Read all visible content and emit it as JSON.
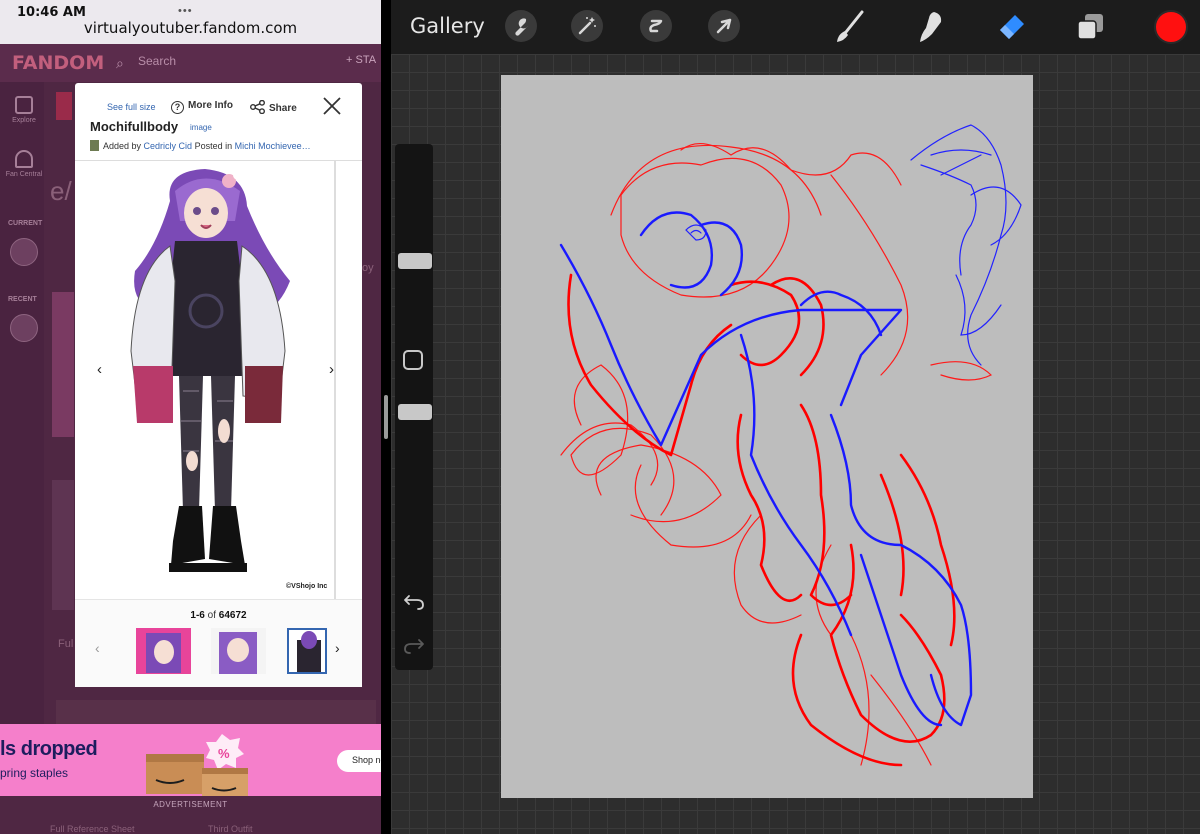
{
  "status_bar": {
    "time": "10:46 AM",
    "dots": "•••",
    "url": "virtualyoutuber.fandom.com"
  },
  "fandom": {
    "logo": "FANDOM",
    "search_placeholder": "Search",
    "start_label": "+ STA",
    "rail": {
      "explore": "Explore",
      "fan_central": "Fan Central",
      "current": "CURRENT",
      "recent": "RECENT"
    },
    "bg_texts": {
      "a": "e/",
      "b": "Ful",
      "c": "oy",
      "d": "Full Reference Sheet",
      "e": "Third Outfit"
    }
  },
  "lightbox": {
    "see_full_size": "See full size",
    "more_info": "More Info",
    "share": "Share",
    "title": "Mochifullbody",
    "type": "image",
    "added_by_prefix": "Added by",
    "added_by_user": "Cedricly Cid",
    "posted_in_prefix": "Posted in",
    "posted_in_page": "Michi Mochievee…",
    "credit": "©VShojo Inc",
    "count_range": "1-6",
    "count_of": "of",
    "count_total": "64672"
  },
  "ad": {
    "title": "ls dropped",
    "subtitle": "pring staples",
    "badge": "%",
    "shop_label": "Shop no",
    "advertisement_label": "ADVERTISEMENT"
  },
  "procreate": {
    "gallery_label": "Gallery",
    "active_tool": "eraser",
    "current_color": "#ff1010",
    "icons": [
      "wrench-icon",
      "magic-wand-icon",
      "selection-icon",
      "transform-arrow-icon",
      "brush-icon",
      "smudge-icon",
      "eraser-icon",
      "layers-icon"
    ]
  }
}
